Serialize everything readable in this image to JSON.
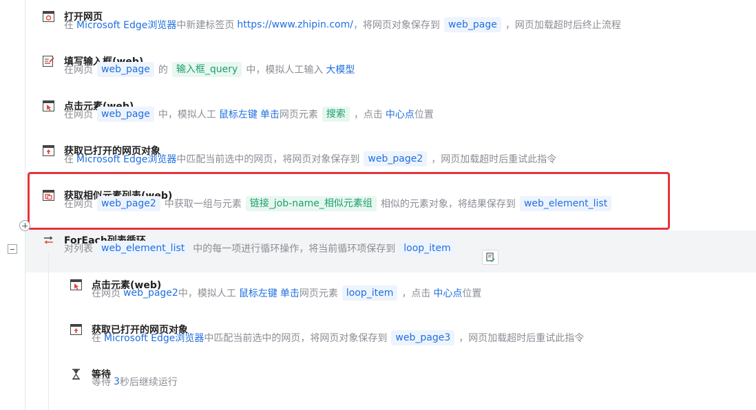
{
  "steps": [
    {
      "title": "打开网页",
      "parts": [
        {
          "t": "text",
          "v": "在"
        },
        {
          "t": "kw",
          "v": "Microsoft Edge浏览器"
        },
        {
          "t": "text",
          "v": "中新建标签页"
        },
        {
          "t": "kw",
          "v": "https://www.zhipin.com/"
        },
        {
          "t": "text",
          "v": "，将网页对象保存到"
        },
        {
          "t": "var",
          "v": "web_page"
        },
        {
          "t": "text",
          "v": "，网页加载超时后终止流程"
        }
      ]
    },
    {
      "title": "填写输入框(web)",
      "parts": [
        {
          "t": "text",
          "v": "在网页"
        },
        {
          "t": "var",
          "v": "web_page"
        },
        {
          "t": "text",
          "v": "的"
        },
        {
          "t": "elem",
          "v": "输入框_query"
        },
        {
          "t": "text",
          "v": "中，模拟人工输入"
        },
        {
          "t": "kw",
          "v": "大模型"
        }
      ]
    },
    {
      "title": "点击元素(web)",
      "parts": [
        {
          "t": "text",
          "v": "在网页"
        },
        {
          "t": "var",
          "v": "web_page"
        },
        {
          "t": "text",
          "v": "中，模拟人工"
        },
        {
          "t": "kw",
          "v": "鼠标左键"
        },
        {
          "t": "kw",
          "v": "单击"
        },
        {
          "t": "text",
          "v": "网页元素"
        },
        {
          "t": "elem",
          "v": "搜索"
        },
        {
          "t": "text",
          "v": "，点击"
        },
        {
          "t": "kw",
          "v": "中心点"
        },
        {
          "t": "text",
          "v": "位置"
        }
      ]
    },
    {
      "title": "获取已打开的网页对象",
      "parts": [
        {
          "t": "text",
          "v": "在"
        },
        {
          "t": "kw",
          "v": "Microsoft Edge浏览器"
        },
        {
          "t": "text",
          "v": "中匹配当前选中的网页，将网页对象保存到"
        },
        {
          "t": "var",
          "v": "web_page2"
        },
        {
          "t": "text",
          "v": "，网页加载超时后重试此指令"
        }
      ]
    },
    {
      "title": "获取相似元素列表(web)",
      "parts": [
        {
          "t": "text",
          "v": "在网页"
        },
        {
          "t": "var",
          "v": "web_page2"
        },
        {
          "t": "text",
          "v": "中获取一组与元素"
        },
        {
          "t": "elem",
          "v": "链接_job-name_相似元素组"
        },
        {
          "t": "text",
          "v": "相似的元素对象，将结果保存到"
        },
        {
          "t": "var",
          "v": "web_element_list"
        }
      ]
    },
    {
      "title": "ForEach列表循环",
      "parts": [
        {
          "t": "text",
          "v": "对列表"
        },
        {
          "t": "var",
          "v": "web_element_list"
        },
        {
          "t": "text",
          "v": "中的每一项进行循环操作，将当前循环项保存到"
        },
        {
          "t": "var",
          "v": "loop_item"
        }
      ]
    },
    {
      "title": "点击元素(web)",
      "parts": [
        {
          "t": "text",
          "v": "在网页"
        },
        {
          "t": "kw",
          "v": "web_page2"
        },
        {
          "t": "text",
          "v": "中，模拟人工"
        },
        {
          "t": "kw",
          "v": "鼠标左键"
        },
        {
          "t": "kw",
          "v": "单击"
        },
        {
          "t": "text",
          "v": "网页元素"
        },
        {
          "t": "var",
          "v": "loop_item"
        },
        {
          "t": "text",
          "v": "，点击"
        },
        {
          "t": "kw",
          "v": "中心点"
        },
        {
          "t": "text",
          "v": "位置"
        }
      ]
    },
    {
      "title": "获取已打开的网页对象",
      "parts": [
        {
          "t": "text",
          "v": "在"
        },
        {
          "t": "kw",
          "v": "Microsoft Edge浏览器"
        },
        {
          "t": "text",
          "v": "中匹配当前选中的网页，将网页对象保存到"
        },
        {
          "t": "var",
          "v": "web_page3"
        },
        {
          "t": "text",
          "v": "，网页加载超时后重试此指令"
        }
      ]
    },
    {
      "title": "等待",
      "parts": [
        {
          "t": "text",
          "v": "等待"
        },
        {
          "t": "kw",
          "v": "3"
        },
        {
          "t": "text",
          "v": "秒后继续运行"
        }
      ]
    }
  ],
  "icons": [
    "browser-open-icon",
    "input-fill-icon",
    "click-element-icon",
    "browser-get-icon",
    "element-list-icon",
    "foreach-loop-icon",
    "click-element-icon",
    "browser-get-icon",
    "hourglass-icon"
  ],
  "colors": {
    "accent": "#1f6fe0",
    "element_green": "#1aa06e",
    "highlight_red": "#e8313b",
    "icon_red": "#e14b3b"
  }
}
